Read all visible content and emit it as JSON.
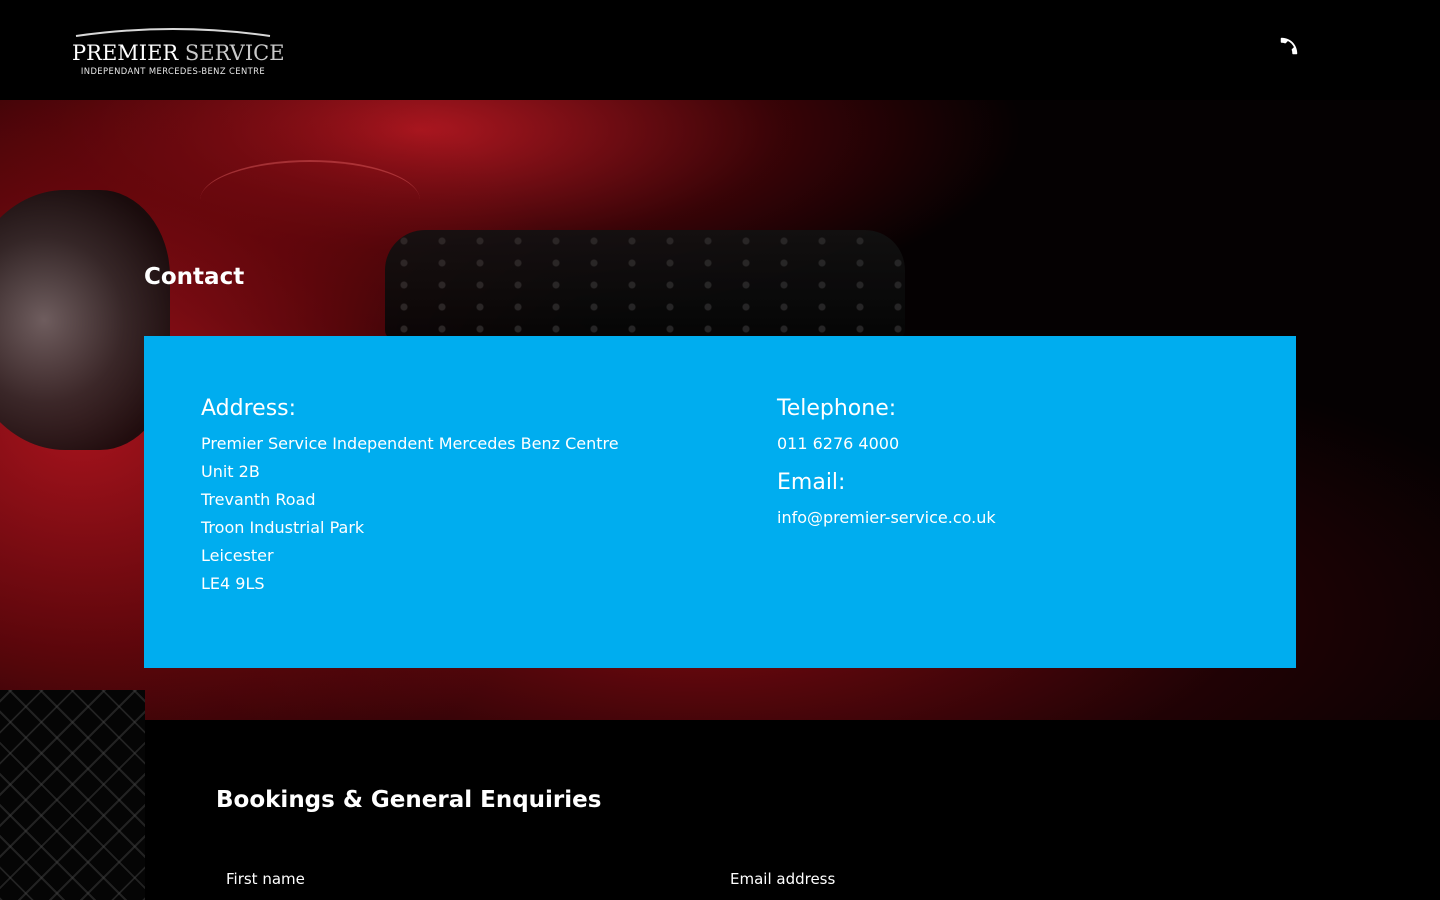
{
  "header": {
    "logo_main_a": "PREMIER",
    "logo_main_b": "SERVICE",
    "logo_sub": "INDEPENDANT MERCEDES-BENZ CENTRE",
    "phone_icon": "phone-icon"
  },
  "hero": {
    "title": "Contact"
  },
  "contact": {
    "address_heading": "Address:",
    "address_lines": [
      "Premier Service Independent Mercedes Benz Centre",
      "Unit 2B",
      "Trevanth Road",
      "Troon Industrial Park",
      "Leicester",
      "LE4 9LS"
    ],
    "telephone_heading": "Telephone:",
    "telephone": "011 6276 4000",
    "email_heading": "Email:",
    "email": "info@premier-service.co.uk"
  },
  "form": {
    "title": "Bookings & General Enquiries",
    "first_name_label": "First name",
    "email_label": "Email address"
  },
  "colors": {
    "accent": "#00adef",
    "background": "#000000",
    "text": "#ffffff"
  }
}
